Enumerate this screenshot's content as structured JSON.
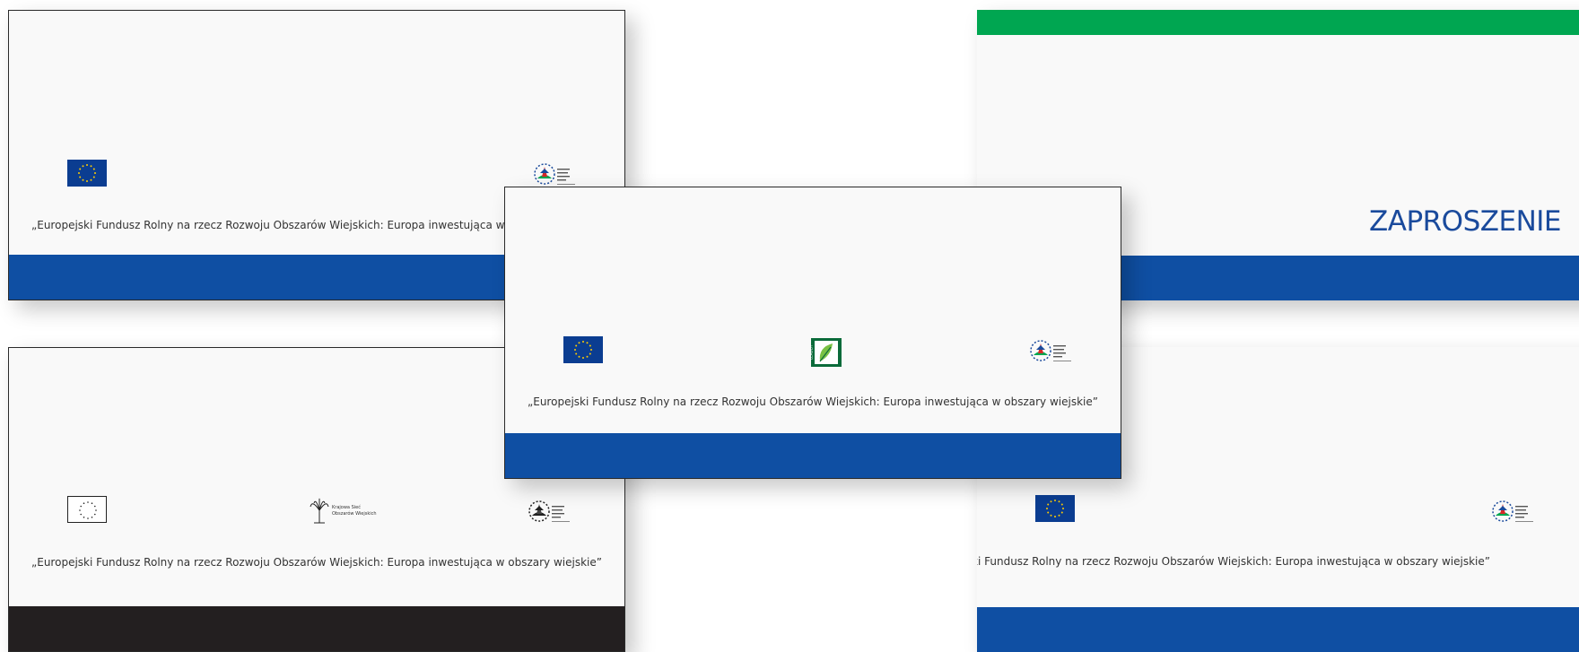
{
  "cards": {
    "top_left": {
      "tagline": "„Europejski Fundusz Rolny na rzecz Rozwoju Obszarów Wiejskich: Europa inwestująca w obszary wiejskie”"
    },
    "center": {
      "tagline": "„Europejski Fundusz Rolny na rzecz Rozwoju Obszarów Wiejskich: Europa inwestująca w obszary wiejskie”"
    },
    "bottom_left": {
      "tagline": "„Europejski Fundusz Rolny na rzecz Rozwoju Obszarów Wiejskich: Europa inwestująca w obszary wiejskie”",
      "network_logo_line1": "Krajowa Sieć",
      "network_logo_line2": "Obszarów Wiejskich"
    },
    "right_top": {
      "title": "ZAPROSZENIE"
    },
    "right_bottom": {
      "tagline": "„Europejski Fundusz Rolny na rzecz Rozwoju Obszarów Wiejskich: Europa inwestująca w obszary wiejskie”"
    }
  },
  "colors": {
    "blue_band": "#0f4fa3",
    "green_band": "#00a651",
    "black_band": "#231f20",
    "title_blue": "#1a4a9c",
    "eu_blue": "#0b3d91",
    "eu_star": "#ffcc00"
  },
  "icons": [
    "eu-flag-icon",
    "prow-logo-icon",
    "leader-logo-icon",
    "ksow-logo-icon"
  ]
}
